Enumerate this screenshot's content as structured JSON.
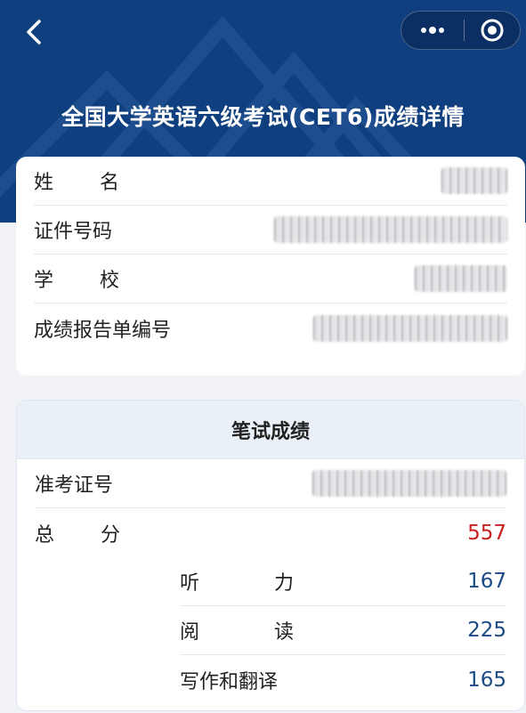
{
  "header": {
    "title": "全国大学英语六级考试(CET6)成绩详情",
    "back_icon": "chevron-left-icon",
    "menu_icons": [
      "more-dots-icon",
      "close-target-icon"
    ],
    "colors": {
      "header_bg": "#0f3f7e",
      "total_score": "#c8201d",
      "score": "#1c4a86"
    }
  },
  "personal": {
    "name_label": "姓名",
    "id_label": "证件号码",
    "school_label": "学校",
    "report_label": "成绩报告单编号"
  },
  "written": {
    "section_title": "笔试成绩",
    "exam_no_label": "准考证号",
    "total_label": "总分",
    "total_score": "557",
    "items": [
      {
        "label": "听力",
        "score": "167"
      },
      {
        "label": "阅读",
        "score": "225"
      },
      {
        "label": "写作和翻译",
        "score": "165"
      }
    ]
  }
}
